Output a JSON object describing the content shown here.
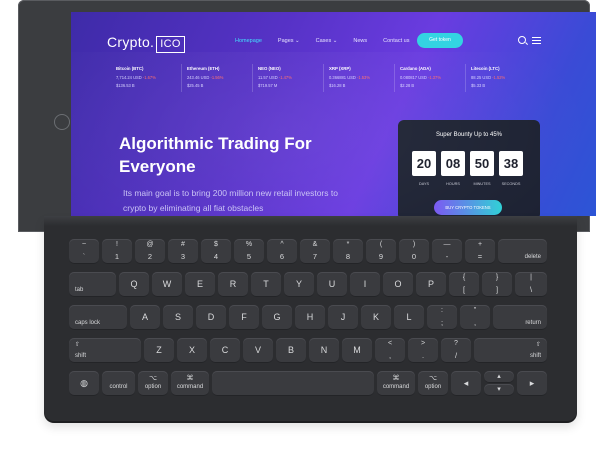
{
  "website": {
    "logo_text": "Crypto.",
    "logo_box": "ICO",
    "nav": [
      "Homepage",
      "Pages ⌄",
      "Cases ⌄",
      "News",
      "Contact us"
    ],
    "get_token": "Get token",
    "ticker": [
      {
        "name": "Bitcoin (BTC)",
        "price": "7,714.24 USD",
        "change": "-1.67%",
        "cap": "$136.53 B"
      },
      {
        "name": "Ethereum (ETH)",
        "price": "243.46 USD",
        "change": "-1.56%",
        "cap": "$25.45 B"
      },
      {
        "name": "NEO (NEO)",
        "price": "11.57 USD",
        "change": "-1.47%",
        "cap": "$719.57 M"
      },
      {
        "name": "XRP (XRP)",
        "price": "0.366881 USD",
        "change": "-1.53%",
        "cap": "$16.28 B"
      },
      {
        "name": "Cardano (ADA)",
        "price": "0.080817 USD",
        "change": "-1.37%",
        "cap": "$2.28 B"
      },
      {
        "name": "Litecoin (LTC)",
        "price": "88.25 USD",
        "change": "-1.52%",
        "cap": "$5.33 B"
      }
    ],
    "hero_title": "Algorithmic Trading For Everyone",
    "hero_sub": "Its main goal is to bring 200 million new retail investors to crypto by eliminating all fiat obstacles",
    "bounty": {
      "title": "Super Bounty Up to 45%",
      "values": [
        "20",
        "08",
        "50",
        "38"
      ],
      "labels": [
        "DAYS",
        "HOURS",
        "MINUTES",
        "SECONDS"
      ],
      "buy_label": "BUY CRYPTO TOKENS"
    }
  },
  "keyboard": {
    "row1": [
      {
        "t": "~",
        "b": "`"
      },
      {
        "t": "!",
        "b": "1"
      },
      {
        "t": "@",
        "b": "2"
      },
      {
        "t": "#",
        "b": "3"
      },
      {
        "t": "$",
        "b": "4"
      },
      {
        "t": "%",
        "b": "5"
      },
      {
        "t": "^",
        "b": "6"
      },
      {
        "t": "&",
        "b": "7"
      },
      {
        "t": "*",
        "b": "8"
      },
      {
        "t": "(",
        "b": "9"
      },
      {
        "t": ")",
        "b": "0"
      },
      {
        "t": "—",
        "b": "-"
      },
      {
        "t": "+",
        "b": "="
      }
    ],
    "delete": "delete",
    "tab": "tab",
    "row2": [
      "Q",
      "W",
      "E",
      "R",
      "T",
      "Y",
      "U",
      "I",
      "O",
      "P"
    ],
    "row2_sym": [
      {
        "t": "{",
        "b": "["
      },
      {
        "t": "}",
        "b": "]"
      },
      {
        "t": "|",
        "b": "\\"
      }
    ],
    "caps_lock": "caps lock",
    "row3": [
      "A",
      "S",
      "D",
      "F",
      "G",
      "H",
      "J",
      "K",
      "L"
    ],
    "row3_sym": [
      {
        "t": ":",
        "b": ";"
      },
      {
        "t": "\"",
        "b": ","
      }
    ],
    "return": "return",
    "shift": "shift",
    "row4": [
      "Z",
      "X",
      "C",
      "V",
      "B",
      "N",
      "M"
    ],
    "row4_sym": [
      {
        "t": "<",
        "b": ","
      },
      {
        "t": ">",
        "b": "."
      },
      {
        "t": "?",
        "b": "/"
      }
    ],
    "globe_glyph": "◍",
    "control": "control",
    "option": "option",
    "command": "command",
    "option_glyph": "⌥",
    "command_glyph": "⌘",
    "arrows": {
      "left": "◂",
      "up": "▴",
      "down": "▾",
      "right": "▸"
    }
  }
}
